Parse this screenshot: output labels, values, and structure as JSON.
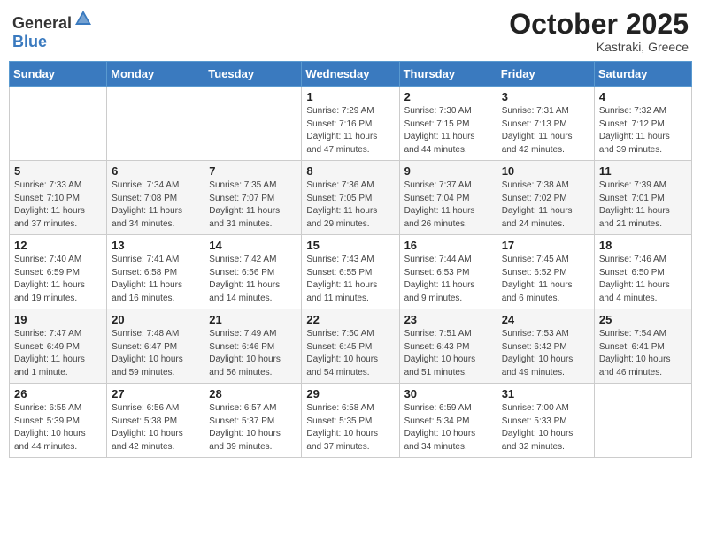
{
  "header": {
    "logo_general": "General",
    "logo_blue": "Blue",
    "month": "October 2025",
    "location": "Kastraki, Greece"
  },
  "weekdays": [
    "Sunday",
    "Monday",
    "Tuesday",
    "Wednesday",
    "Thursday",
    "Friday",
    "Saturday"
  ],
  "weeks": [
    [
      {
        "day": "",
        "info": ""
      },
      {
        "day": "",
        "info": ""
      },
      {
        "day": "",
        "info": ""
      },
      {
        "day": "1",
        "info": "Sunrise: 7:29 AM\nSunset: 7:16 PM\nDaylight: 11 hours\nand 47 minutes."
      },
      {
        "day": "2",
        "info": "Sunrise: 7:30 AM\nSunset: 7:15 PM\nDaylight: 11 hours\nand 44 minutes."
      },
      {
        "day": "3",
        "info": "Sunrise: 7:31 AM\nSunset: 7:13 PM\nDaylight: 11 hours\nand 42 minutes."
      },
      {
        "day": "4",
        "info": "Sunrise: 7:32 AM\nSunset: 7:12 PM\nDaylight: 11 hours\nand 39 minutes."
      }
    ],
    [
      {
        "day": "5",
        "info": "Sunrise: 7:33 AM\nSunset: 7:10 PM\nDaylight: 11 hours\nand 37 minutes."
      },
      {
        "day": "6",
        "info": "Sunrise: 7:34 AM\nSunset: 7:08 PM\nDaylight: 11 hours\nand 34 minutes."
      },
      {
        "day": "7",
        "info": "Sunrise: 7:35 AM\nSunset: 7:07 PM\nDaylight: 11 hours\nand 31 minutes."
      },
      {
        "day": "8",
        "info": "Sunrise: 7:36 AM\nSunset: 7:05 PM\nDaylight: 11 hours\nand 29 minutes."
      },
      {
        "day": "9",
        "info": "Sunrise: 7:37 AM\nSunset: 7:04 PM\nDaylight: 11 hours\nand 26 minutes."
      },
      {
        "day": "10",
        "info": "Sunrise: 7:38 AM\nSunset: 7:02 PM\nDaylight: 11 hours\nand 24 minutes."
      },
      {
        "day": "11",
        "info": "Sunrise: 7:39 AM\nSunset: 7:01 PM\nDaylight: 11 hours\nand 21 minutes."
      }
    ],
    [
      {
        "day": "12",
        "info": "Sunrise: 7:40 AM\nSunset: 6:59 PM\nDaylight: 11 hours\nand 19 minutes."
      },
      {
        "day": "13",
        "info": "Sunrise: 7:41 AM\nSunset: 6:58 PM\nDaylight: 11 hours\nand 16 minutes."
      },
      {
        "day": "14",
        "info": "Sunrise: 7:42 AM\nSunset: 6:56 PM\nDaylight: 11 hours\nand 14 minutes."
      },
      {
        "day": "15",
        "info": "Sunrise: 7:43 AM\nSunset: 6:55 PM\nDaylight: 11 hours\nand 11 minutes."
      },
      {
        "day": "16",
        "info": "Sunrise: 7:44 AM\nSunset: 6:53 PM\nDaylight: 11 hours\nand 9 minutes."
      },
      {
        "day": "17",
        "info": "Sunrise: 7:45 AM\nSunset: 6:52 PM\nDaylight: 11 hours\nand 6 minutes."
      },
      {
        "day": "18",
        "info": "Sunrise: 7:46 AM\nSunset: 6:50 PM\nDaylight: 11 hours\nand 4 minutes."
      }
    ],
    [
      {
        "day": "19",
        "info": "Sunrise: 7:47 AM\nSunset: 6:49 PM\nDaylight: 11 hours\nand 1 minute."
      },
      {
        "day": "20",
        "info": "Sunrise: 7:48 AM\nSunset: 6:47 PM\nDaylight: 10 hours\nand 59 minutes."
      },
      {
        "day": "21",
        "info": "Sunrise: 7:49 AM\nSunset: 6:46 PM\nDaylight: 10 hours\nand 56 minutes."
      },
      {
        "day": "22",
        "info": "Sunrise: 7:50 AM\nSunset: 6:45 PM\nDaylight: 10 hours\nand 54 minutes."
      },
      {
        "day": "23",
        "info": "Sunrise: 7:51 AM\nSunset: 6:43 PM\nDaylight: 10 hours\nand 51 minutes."
      },
      {
        "day": "24",
        "info": "Sunrise: 7:53 AM\nSunset: 6:42 PM\nDaylight: 10 hours\nand 49 minutes."
      },
      {
        "day": "25",
        "info": "Sunrise: 7:54 AM\nSunset: 6:41 PM\nDaylight: 10 hours\nand 46 minutes."
      }
    ],
    [
      {
        "day": "26",
        "info": "Sunrise: 6:55 AM\nSunset: 5:39 PM\nDaylight: 10 hours\nand 44 minutes."
      },
      {
        "day": "27",
        "info": "Sunrise: 6:56 AM\nSunset: 5:38 PM\nDaylight: 10 hours\nand 42 minutes."
      },
      {
        "day": "28",
        "info": "Sunrise: 6:57 AM\nSunset: 5:37 PM\nDaylight: 10 hours\nand 39 minutes."
      },
      {
        "day": "29",
        "info": "Sunrise: 6:58 AM\nSunset: 5:35 PM\nDaylight: 10 hours\nand 37 minutes."
      },
      {
        "day": "30",
        "info": "Sunrise: 6:59 AM\nSunset: 5:34 PM\nDaylight: 10 hours\nand 34 minutes."
      },
      {
        "day": "31",
        "info": "Sunrise: 7:00 AM\nSunset: 5:33 PM\nDaylight: 10 hours\nand 32 minutes."
      },
      {
        "day": "",
        "info": ""
      }
    ]
  ]
}
